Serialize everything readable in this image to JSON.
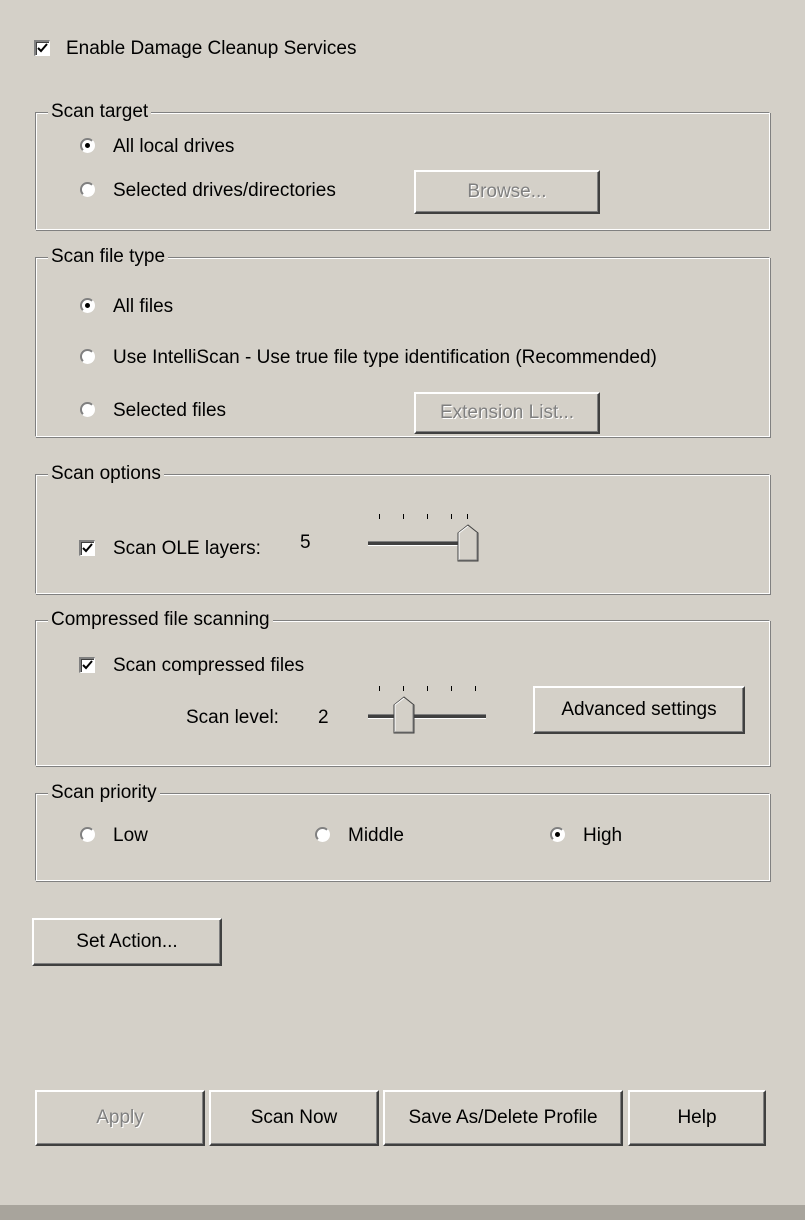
{
  "enable": {
    "label": "Enable Damage Cleanup Services",
    "checked": true
  },
  "scan_target": {
    "title": "Scan target",
    "options": [
      "All local drives",
      "Selected drives/directories"
    ],
    "selected": 0,
    "browse_label": "Browse..."
  },
  "scan_file_type": {
    "title": "Scan file type",
    "options": [
      "All files",
      "Use IntelliScan - Use true file type identification (Recommended)",
      "Selected files"
    ],
    "selected": 0,
    "extension_list_label": "Extension List..."
  },
  "scan_options": {
    "title": "Scan options",
    "ole_label": "Scan OLE layers:",
    "ole_checked": true,
    "ole_value": "5"
  },
  "compressed": {
    "title": "Compressed file scanning",
    "scan_compressed_label": "Scan compressed files",
    "checked": true,
    "level_label": "Scan level:",
    "level_value": "2",
    "advanced_label": "Advanced settings"
  },
  "priority": {
    "title": "Scan priority",
    "options": [
      "Low",
      "Middle",
      "High"
    ],
    "selected": 2
  },
  "set_action_label": "Set Action...",
  "footer": {
    "apply": "Apply",
    "scan_now": "Scan Now",
    "save_profile": "Save As/Delete Profile",
    "help": "Help"
  },
  "colors": {
    "background": "#d4d0c8",
    "disabled_text": "#808080"
  }
}
